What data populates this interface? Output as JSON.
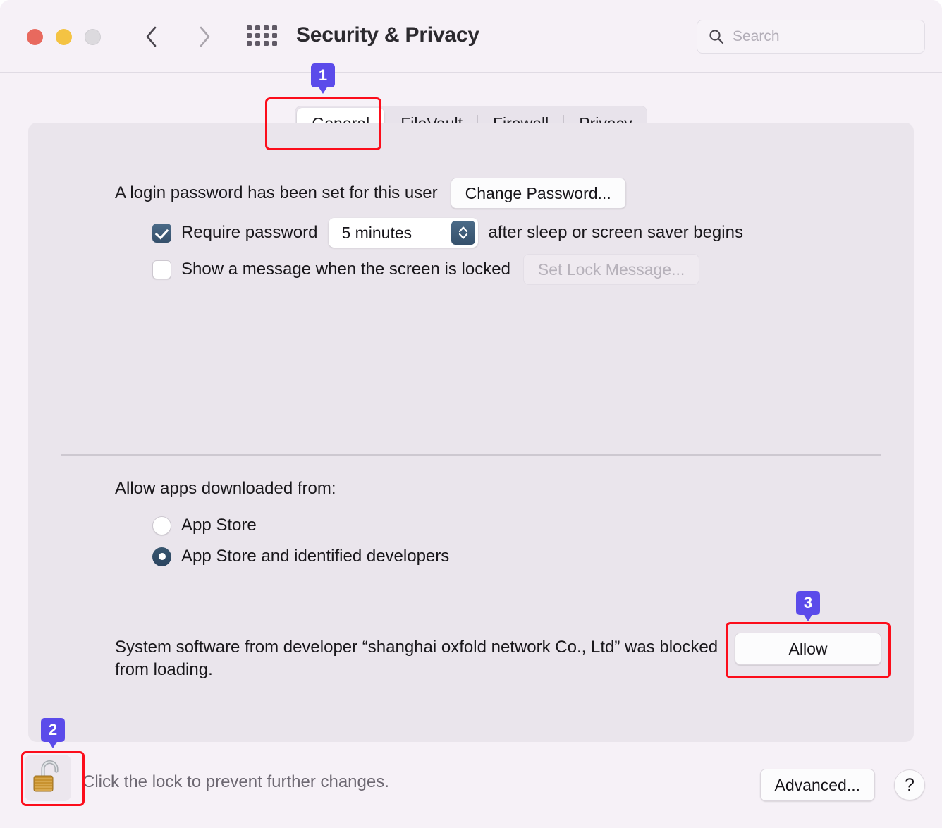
{
  "window": {
    "title": "Security & Privacy",
    "traffic_lights": [
      "close-red",
      "minimize-yellow",
      "zoom-gray"
    ],
    "nav": {
      "back": "back-chevron",
      "forward": "forward-chevron",
      "grid": "show-all-grid"
    }
  },
  "search": {
    "placeholder": "Search",
    "value": "",
    "icon": "search-icon"
  },
  "tabs": [
    {
      "label": "General",
      "selected": true
    },
    {
      "label": "FileVault",
      "selected": false
    },
    {
      "label": "Firewall",
      "selected": false
    },
    {
      "label": "Privacy",
      "selected": false
    }
  ],
  "general": {
    "password_status": "A login password has been set for this user",
    "change_password_label": "Change Password...",
    "require_password": {
      "checked": true,
      "label": "Require password",
      "delay_value": "5 minutes",
      "suffix": "after sleep or screen saver begins"
    },
    "lock_message": {
      "checked": false,
      "label": "Show a message when the screen is locked",
      "button_label": "Set Lock Message...",
      "button_disabled": true
    },
    "allow_apps": {
      "heading": "Allow apps downloaded from:",
      "options": [
        {
          "label": "App Store",
          "selected": false
        },
        {
          "label": "App Store and identified developers",
          "selected": true
        }
      ]
    },
    "blocked_software": {
      "message": "System software from developer “shanghai oxfold network Co., Ltd” was blocked from loading.",
      "allow_label": "Allow"
    }
  },
  "footer": {
    "lock_icon": "unlocked-padlock-icon",
    "note": "Click the lock to prevent further changes.",
    "advanced_label": "Advanced...",
    "help_label": "?"
  },
  "annotations": {
    "badges": [
      {
        "number": "1",
        "target": "general-tab"
      },
      {
        "number": "2",
        "target": "lock-button"
      },
      {
        "number": "3",
        "target": "allow-button"
      }
    ],
    "highlight_color": "#fc0d1b",
    "badge_color": "#5b4bea"
  }
}
